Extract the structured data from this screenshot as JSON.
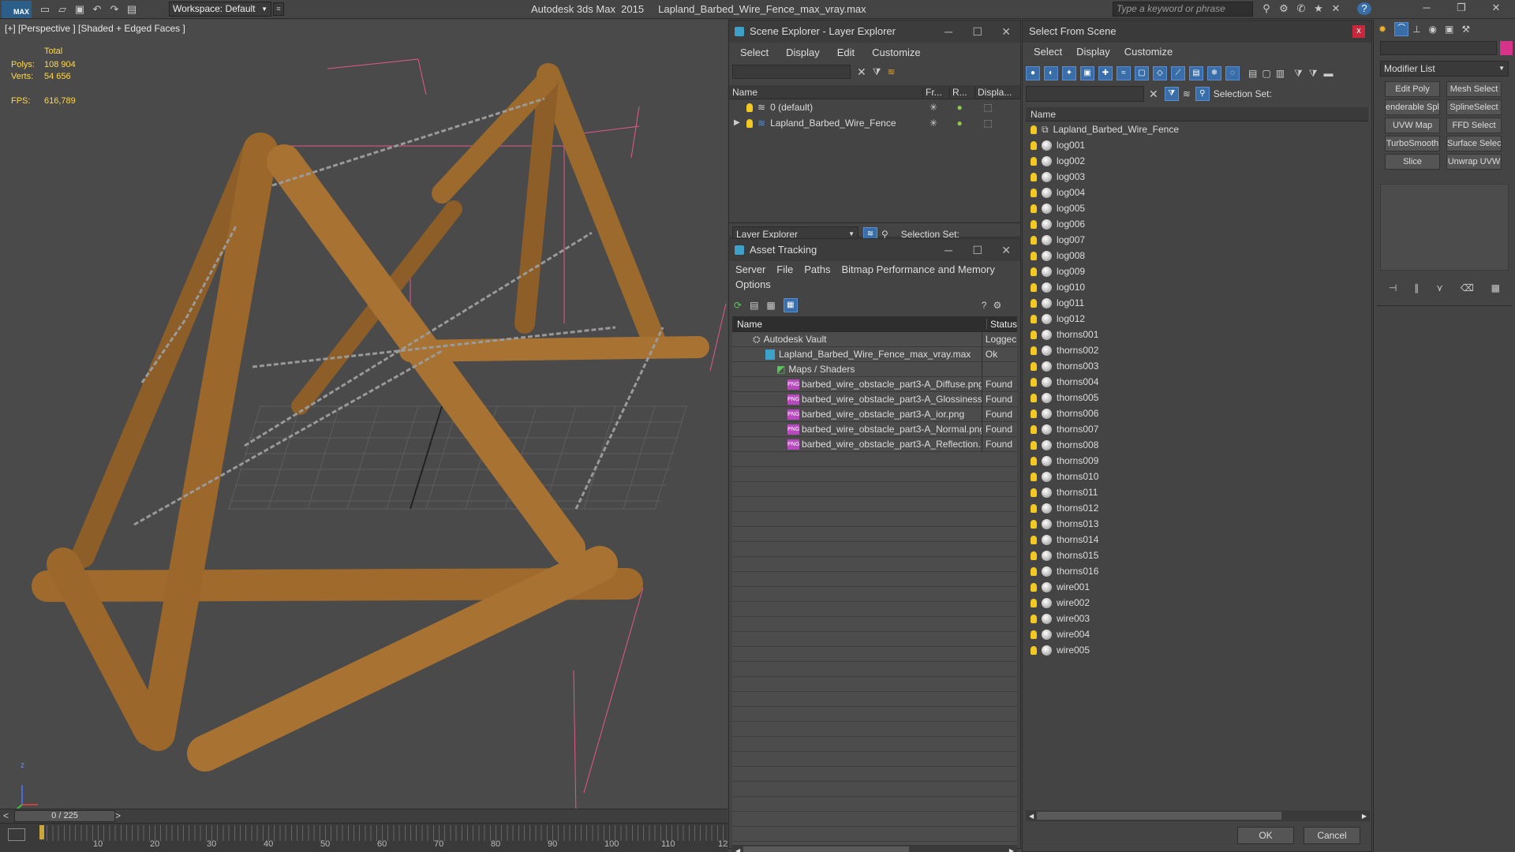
{
  "titlebar": {
    "app_title": "Autodesk 3ds Max  2015     Lapland_Barbed_Wire_Fence_max_vray.max",
    "workspace": "Workspace: Default",
    "search_placeholder": "Type a keyword or phrase",
    "logo": "MAX"
  },
  "viewport": {
    "label": "[+] [Perspective ] [Shaded + Edged Faces ]",
    "stats": {
      "total_label": "Total",
      "polys_label": "Polys:",
      "polys_value": "108 904",
      "verts_label": "Verts:",
      "verts_value": "54 656",
      "fps_label": "FPS:",
      "fps_value": "616,789"
    },
    "axis_label": "z",
    "colors": {
      "bg": "#4a4a4a",
      "wood": "#a06a2c",
      "wire": "#9a9a9a",
      "bounds": "#e05a8a"
    }
  },
  "timeline": {
    "frame_display": "0 / 225",
    "prev": "<",
    "next": ">",
    "ticks": [
      "10",
      "20",
      "30",
      "40",
      "50",
      "60",
      "70",
      "80",
      "90",
      "100",
      "110",
      "12"
    ]
  },
  "layer_explorer": {
    "title": "Scene Explorer - Layer Explorer",
    "menu": [
      "Select",
      "Display",
      "Edit",
      "Customize"
    ],
    "columns": {
      "name": "Name",
      "freeze": "Fr...",
      "render": "R...",
      "display": "Displa..."
    },
    "layers": [
      {
        "name": "0 (default)"
      },
      {
        "name": "Lapland_Barbed_Wire_Fence"
      }
    ],
    "footer_select": "Layer Explorer",
    "selection_set": "Selection Set:"
  },
  "asset_tracking": {
    "title": "Asset Tracking",
    "menu": [
      "Server",
      "File",
      "Paths",
      "Bitmap Performance and Memory"
    ],
    "menu2": [
      "Options"
    ],
    "columns": {
      "name": "Name",
      "status": "Status"
    },
    "rows": [
      {
        "name": "Autodesk Vault",
        "status": "Loggec"
      },
      {
        "name": "Lapland_Barbed_Wire_Fence_max_vray.max",
        "status": "Ok"
      },
      {
        "name": "Maps / Shaders",
        "status": ""
      },
      {
        "name": "barbed_wire_obstacle_part3-A_Diffuse.png",
        "status": "Found"
      },
      {
        "name": "barbed_wire_obstacle_part3-A_Glossiness....",
        "status": "Found"
      },
      {
        "name": "barbed_wire_obstacle_part3-A_ior.png",
        "status": "Found"
      },
      {
        "name": "barbed_wire_obstacle_part3-A_Normal.png",
        "status": "Found"
      },
      {
        "name": "barbed_wire_obstacle_part3-A_Reflection....",
        "status": "Found"
      }
    ],
    "png_badge": "PNG"
  },
  "select_from_scene": {
    "title": "Select From Scene",
    "menu": [
      "Select",
      "Display",
      "Customize"
    ],
    "selection_set": "Selection Set:",
    "column_name": "Name",
    "objects": [
      "Lapland_Barbed_Wire_Fence",
      "log001",
      "log002",
      "log003",
      "log004",
      "log005",
      "log006",
      "log007",
      "log008",
      "log009",
      "log010",
      "log011",
      "log012",
      "thorns001",
      "thorns002",
      "thorns003",
      "thorns004",
      "thorns005",
      "thorns006",
      "thorns007",
      "thorns008",
      "thorns009",
      "thorns010",
      "thorns011",
      "thorns012",
      "thorns013",
      "thorns014",
      "thorns015",
      "thorns016",
      "wire001",
      "wire002",
      "wire003",
      "wire004",
      "wire005"
    ],
    "ok": "OK",
    "cancel": "Cancel",
    "close": "x"
  },
  "command_panel": {
    "modifier_list": "Modifier List",
    "buttons": [
      "Edit Poly",
      "Mesh Select",
      "enderable Splir",
      "SplineSelect",
      "UVW Map",
      "FFD Select",
      "TurboSmooth",
      "Surface Select",
      "Slice",
      "Unwrap UVW"
    ]
  }
}
